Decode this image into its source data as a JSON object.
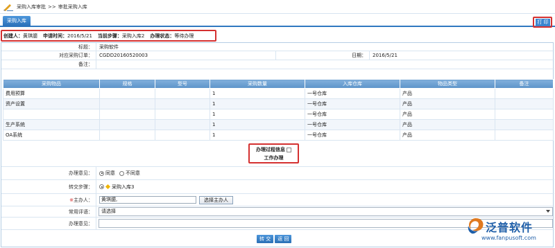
{
  "breadcrumb": {
    "part1": "采购入库审批",
    "sep": ">>",
    "part2": "审批采购入库"
  },
  "tab": {
    "label": "采购入库"
  },
  "print": {
    "label": "打 印"
  },
  "info": {
    "creator_label": "创建人：",
    "creator": "黄琪臆",
    "time_label": "申请时间：",
    "time": "2016/5/21",
    "step_label": "当前步骤：",
    "step": "采购入库2",
    "state_label": "办理状态：",
    "state": "等待办理"
  },
  "form": {
    "title_label": "标题：",
    "title": "采购软件",
    "order_label": "对应采购订单：",
    "order": "CGDD20160520003",
    "date_label": "日期：",
    "date": "2016/5/21",
    "remark_label": "备注：",
    "remark": ""
  },
  "items": {
    "columns": [
      "采购物品",
      "规格",
      "型号",
      "采购数量",
      "入库仓库",
      "物品类型",
      "备注"
    ],
    "rows": [
      [
        "费用预算",
        "",
        "",
        "1",
        "一号仓库",
        "产品",
        ""
      ],
      [
        "资产设置",
        "",
        "",
        "1",
        "一号仓库",
        "产品",
        ""
      ],
      [
        "",
        "",
        "",
        "1",
        "一号仓库",
        "产品",
        ""
      ],
      [
        "生产系统",
        "",
        "",
        "1",
        "一号仓库",
        "产品",
        ""
      ],
      [
        "OA系统",
        "",
        "",
        "1",
        "一号仓库",
        "产品",
        ""
      ]
    ]
  },
  "process": {
    "info_label": "办理过程信息",
    "work_label": "工作办理"
  },
  "handle": {
    "opinion_label": "办理意见：",
    "agree": "同意",
    "disagree": "不同意",
    "transfer_label": "转交步骤：",
    "transfer_step": "采购入库3",
    "host_label": "主办人：",
    "host_required": "※",
    "host_value": "黄琪臆,",
    "select_host": "选择主办人",
    "common_label": "常用评语：",
    "common_value": "请选择",
    "opinion2_label": "办理意见："
  },
  "buttons": {
    "submit": "转 交",
    "back": "返 回"
  },
  "logo": {
    "name": "泛普软件",
    "url": "www.fanpusoft.com"
  },
  "colors": {
    "accent": "#2f78c0",
    "highlight": "#d43030",
    "logo": "#1e5ea8"
  }
}
